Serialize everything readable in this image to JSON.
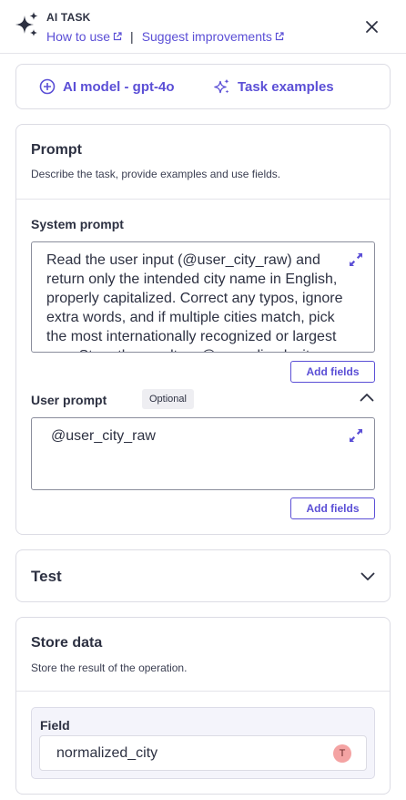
{
  "header": {
    "title": "AI TASK",
    "how_to_use": "How to use",
    "separator": "|",
    "suggest": "Suggest improvements"
  },
  "top_actions": {
    "model_label": "AI model - gpt-4o",
    "examples_label": "Task examples"
  },
  "prompt": {
    "title": "Prompt",
    "subtitle": "Describe the task, provide examples and use fields.",
    "system_label": "System prompt",
    "system_text": "Read the user input (@user_city_raw) and return only the intended city name in English, properly capitalized. Correct any typos, ignore extra words, and if multiple cities match, pick the most internationally recognized or largest one. Store the result as @normalized_city.",
    "add_fields_1": "Add fields",
    "user_label": "User prompt",
    "optional_badge": "Optional",
    "user_text": "@user_city_raw",
    "add_fields_2": "Add fields"
  },
  "test": {
    "title": "Test"
  },
  "store": {
    "title": "Store data",
    "subtitle": "Store the result of the operation.",
    "field_label": "Field",
    "field_value": "normalized_city",
    "avatar_letter": "T"
  },
  "colors": {
    "accent": "#5b4fd6",
    "text": "#2d3142",
    "border": "#dcdce4",
    "avatar_bg": "#f4a3a3"
  },
  "icons": {
    "header": "sparkles-icon",
    "close": "close-icon",
    "model": "plus-circle-icon",
    "examples": "sparkles-icon",
    "expand": "expand-icon",
    "collapse": "chevron-up-icon",
    "test": "chevron-down-icon",
    "external": "external-link-icon"
  }
}
